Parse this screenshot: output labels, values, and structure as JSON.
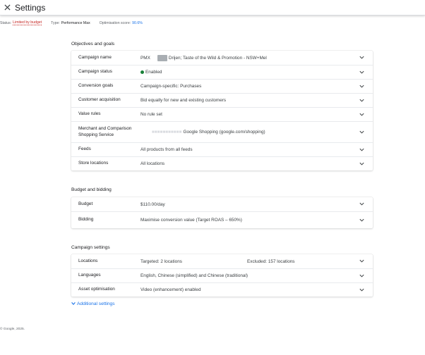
{
  "header": {
    "close_icon": "close-icon",
    "title": "Settings"
  },
  "statusbar": {
    "status_label": "Status:",
    "status_value": "Limited by budget",
    "type_label": "Type:",
    "type_value": "Performance Max",
    "score_label": "Optimisation score:",
    "score_value": "90.6%"
  },
  "objectives": {
    "title": "Objectives and goals",
    "rows": [
      {
        "label": "Campaign name",
        "value_prefix": "PMX",
        "value_suffix": "Drijen; Taste of the Wild & Promotion - NSW+Mel"
      },
      {
        "label": "Campaign status",
        "value": "Enabled"
      },
      {
        "label": "Conversion goals",
        "value": "Campaign-specific: Purchases"
      },
      {
        "label": "Customer acquisition",
        "value": "Bid equally for new and existing customers"
      },
      {
        "label": "Value rules",
        "value": "No rule set"
      },
      {
        "label": "Merchant and Comparison Shopping Service",
        "value": "Google Shopping (google.com/shopping)"
      },
      {
        "label": "Feeds",
        "value": "All products from all feeds"
      },
      {
        "label": "Store locations",
        "value": "All locations"
      }
    ]
  },
  "budget": {
    "title": "Budget and bidding",
    "rows": [
      {
        "label": "Budget",
        "value": "$110.00/day"
      },
      {
        "label": "Bidding",
        "value": "Maximise conversion value (Target ROAS – 650%)"
      }
    ]
  },
  "campaign_settings": {
    "title": "Campaign settings",
    "rows": [
      {
        "label": "Locations",
        "value": "Targeted: 2 locations",
        "value2": "Excluded: 157 locations"
      },
      {
        "label": "Languages",
        "value": "English, Chinese (simplified) and Chinese (traditional)"
      },
      {
        "label": "Asset optimisation",
        "value": "Video (enhancement) enabled"
      }
    ]
  },
  "additional_settings": "Additional settings",
  "footer": "© Google, 2025.",
  "colors": {
    "accent": "#1a73e8",
    "warning": "#c5221f",
    "enabled": "#188038"
  }
}
